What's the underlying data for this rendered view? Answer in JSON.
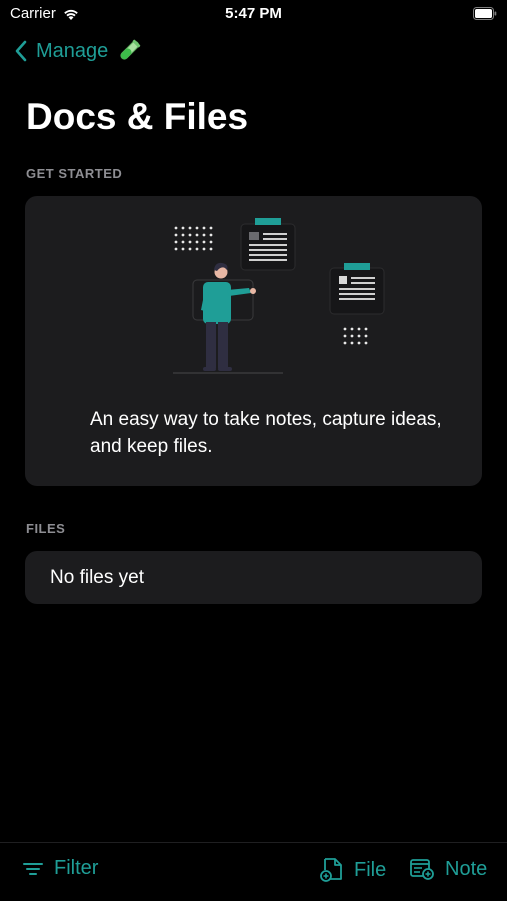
{
  "status_bar": {
    "carrier": "Carrier",
    "time": "5:47 PM"
  },
  "nav": {
    "back_label": "Manage",
    "back_icon": "chevron-left-icon",
    "title_icon": "test-tube-icon"
  },
  "page": {
    "title": "Docs & Files"
  },
  "get_started": {
    "header": "GET STARTED",
    "description": "An easy way to take notes, capture ideas, and keep files.",
    "illustration": "person-with-documents-illustration"
  },
  "files": {
    "header": "FILES",
    "empty_text": "No files yet"
  },
  "toolbar": {
    "filter_label": "Filter",
    "file_label": "File",
    "note_label": "Note"
  },
  "colors": {
    "accent": "#1f9e97",
    "background": "#000000",
    "card": "#1c1c1e",
    "secondary_text": "#8e8e93"
  }
}
